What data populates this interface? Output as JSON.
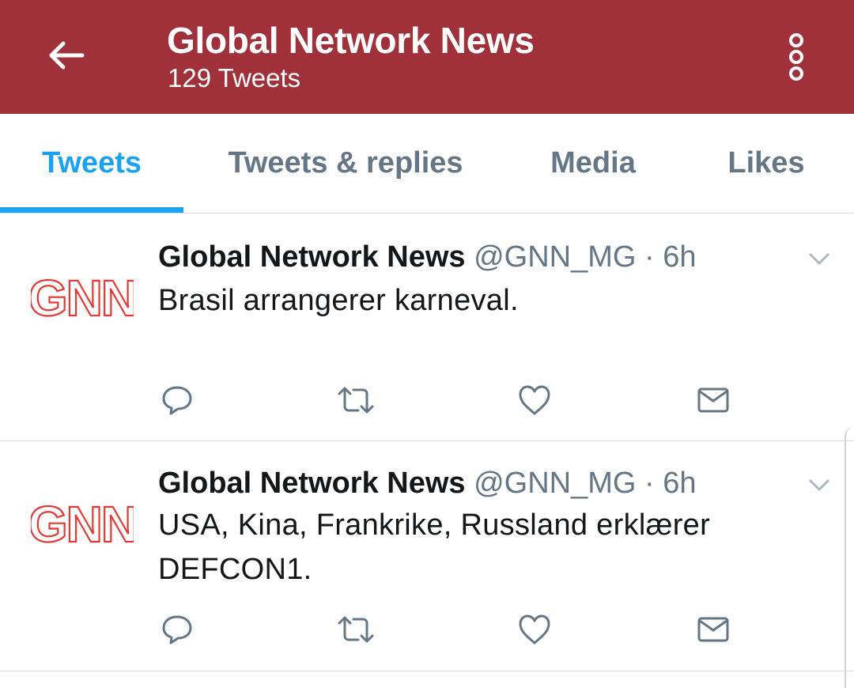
{
  "appbar": {
    "title": "Global Network News",
    "subtitle": "129 Tweets",
    "back_icon": "arrow-left-icon",
    "more_icon": "more-vertical-icon",
    "color": "#a0303a"
  },
  "tabs": [
    {
      "label": "Tweets",
      "active": true
    },
    {
      "label": "Tweets & replies",
      "active": false
    },
    {
      "label": "Media",
      "active": false
    },
    {
      "label": "Likes",
      "active": false
    }
  ],
  "accent_color": "#1da1f2",
  "tweets": [
    {
      "avatar_text": "GNN",
      "author": "Global Network News",
      "handle": "@GNN_MG",
      "separator": "·",
      "time": "6h",
      "text": "Brasil arrangerer karneval.",
      "actions": [
        "reply-icon",
        "retweet-icon",
        "like-icon",
        "message-icon"
      ]
    },
    {
      "avatar_text": "GNN",
      "author": "Global Network News",
      "handle": "@GNN_MG",
      "separator": "·",
      "time": "6h",
      "text": "USA, Kina, Frankrike, Russland erklærer DEFCON1.",
      "actions": [
        "reply-icon",
        "retweet-icon",
        "like-icon",
        "message-icon"
      ]
    }
  ]
}
